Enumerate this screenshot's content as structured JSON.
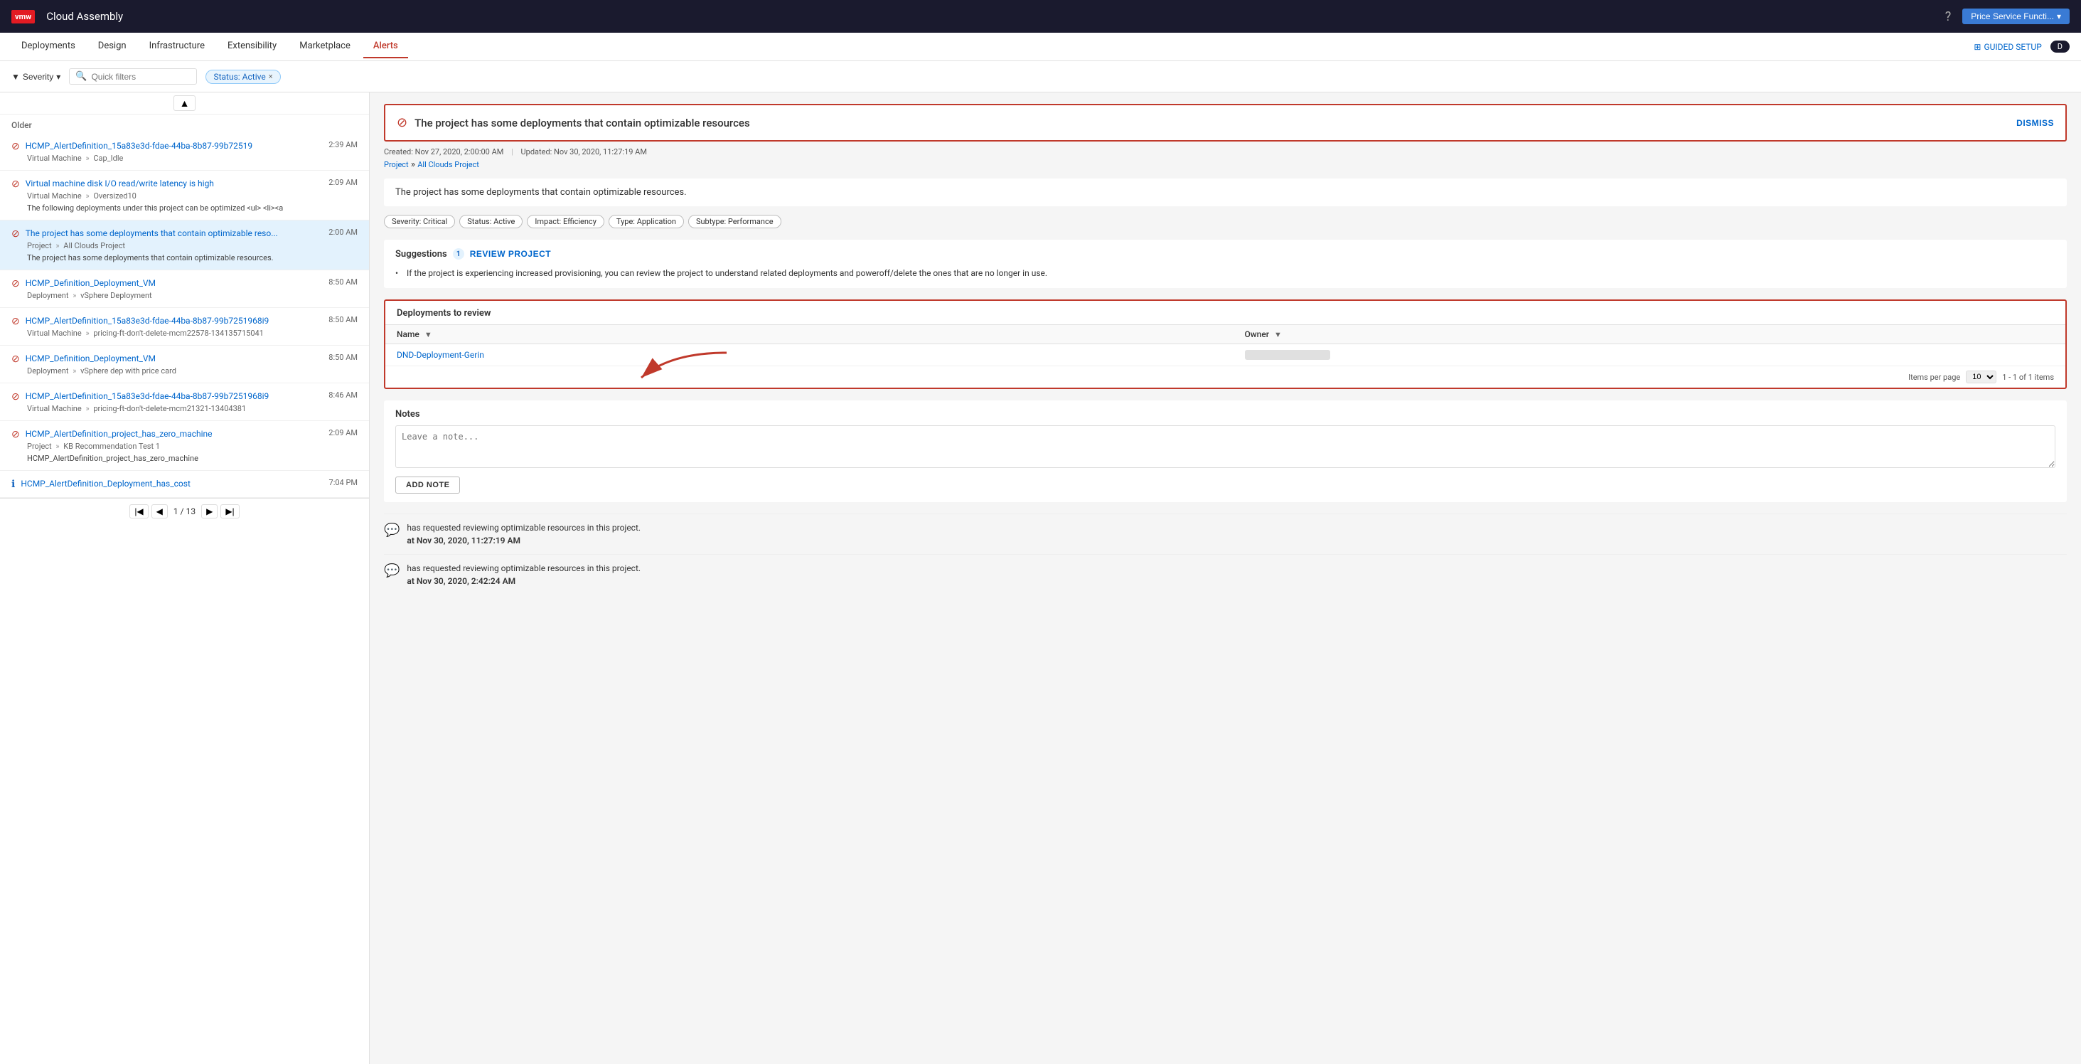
{
  "app": {
    "logo": "vmw",
    "title": "Cloud Assembly"
  },
  "topnav": {
    "user_label": "Price Service Functi...",
    "help_icon": "?",
    "chevron_icon": "▾"
  },
  "menubar": {
    "items": [
      {
        "label": "Deployments",
        "active": false
      },
      {
        "label": "Design",
        "active": false
      },
      {
        "label": "Infrastructure",
        "active": false
      },
      {
        "label": "Extensibility",
        "active": false
      },
      {
        "label": "Marketplace",
        "active": false
      },
      {
        "label": "Alerts",
        "active": true
      }
    ],
    "guided_setup": "GUIDED SETUP",
    "dark_toggle": "D"
  },
  "filterbar": {
    "severity_label": "Severity",
    "quick_filters_placeholder": "Quick filters",
    "status_badge": "Status: Active",
    "status_badge_x": "×"
  },
  "left_panel": {
    "section_label": "Older",
    "alerts": [
      {
        "id": "alert-1",
        "icon_type": "error",
        "title": "HCMP_AlertDefinition_15a83e3d-fdae-44ba-8b87-99b72519",
        "time": "2:39 AM",
        "sub": "Virtual Machine » Cap_Idle",
        "desc": ""
      },
      {
        "id": "alert-2",
        "icon_type": "error",
        "title": "Virtual machine disk I/O read/write latency is high",
        "time": "2:09 AM",
        "sub": "Virtual Machine » Oversized10",
        "desc": "The following deployments under this project can be optimized <ul> <li><a"
      },
      {
        "id": "alert-3",
        "icon_type": "error",
        "title": "The project has some deployments that contain optimizable reso...",
        "time": "2:00 AM",
        "sub": "Project » All Clouds Project",
        "desc": "The project has some deployments that contain optimizable resources.",
        "selected": true
      },
      {
        "id": "alert-4",
        "icon_type": "error",
        "title": "HCMP_Definition_Deployment_VM",
        "time": "8:50 AM",
        "sub": "Deployment » vSphere Deployment",
        "desc": ""
      },
      {
        "id": "alert-5",
        "icon_type": "error",
        "title": "HCMP_AlertDefinition_15a83e3d-fdae-44ba-8b87-99b7251968i9",
        "time": "8:50 AM",
        "sub": "Virtual Machine » pricing-ft-don't-delete-mcm22578-134135715041",
        "desc": ""
      },
      {
        "id": "alert-6",
        "icon_type": "error",
        "title": "HCMP_Definition_Deployment_VM",
        "time": "8:50 AM",
        "sub": "Deployment » vSphere dep with price card",
        "desc": ""
      },
      {
        "id": "alert-7",
        "icon_type": "error",
        "title": "HCMP_AlertDefinition_15a83e3d-fdae-44ba-8b87-99b7251968i9",
        "time": "8:46 AM",
        "sub": "Virtual Machine » pricing-ft-don't-delete-mcm21321-13404381",
        "desc": ""
      },
      {
        "id": "alert-8",
        "icon_type": "error",
        "title": "HCMP_AlertDefinition_project_has_zero_machine",
        "time": "2:09 AM",
        "sub": "Project » KB Recommendation Test 1",
        "desc": "HCMP_AlertDefinition_project_has_zero_machine"
      },
      {
        "id": "alert-9",
        "icon_type": "info",
        "title": "HCMP_AlertDefinition_Deployment_has_cost",
        "time": "7:04 PM",
        "sub": "",
        "desc": ""
      }
    ],
    "pagination": {
      "page": "1",
      "total_pages": "13",
      "prev_disabled": true,
      "next_disabled": false
    }
  },
  "right_panel": {
    "alert_title": "The project has some deployments that contain optimizable resources",
    "dismiss_label": "DISMISS",
    "meta_created": "Created: Nov 27, 2020, 2:00:00 AM",
    "meta_updated": "Updated: Nov 30, 2020, 11:27:19 AM",
    "meta_sep": "|",
    "project_label": "Project",
    "project_link": "All Clouds Project",
    "description": "The project has some deployments that contain optimizable resources.",
    "tags": [
      {
        "label": "Severity: Critical"
      },
      {
        "label": "Status: Active"
      },
      {
        "label": "Impact: Efficiency"
      },
      {
        "label": "Type: Application"
      },
      {
        "label": "Subtype: Performance"
      }
    ],
    "suggestions": {
      "title": "Suggestions",
      "count": "1",
      "review_btn": "REVIEW PROJECT",
      "items": [
        "If the project is experiencing increased provisioning, you can review the project to understand related deployments and poweroff/delete the ones that are no longer in use."
      ]
    },
    "deployments_box": {
      "title": "Deployments to review",
      "columns": [
        {
          "label": "Name"
        },
        {
          "label": "Owner"
        }
      ],
      "rows": [
        {
          "name": "DND-Deployment-Gerin",
          "owner": ""
        }
      ],
      "items_per_page_label": "Items per page",
      "items_per_page_value": "10",
      "count_label": "1 - 1 of 1 items"
    },
    "notes": {
      "title": "Notes",
      "placeholder": "Leave a note...",
      "add_btn": "ADD NOTE"
    },
    "activity": [
      {
        "icon": "💬",
        "text": "has requested reviewing optimizable resources in this project.",
        "time": "at Nov 30, 2020, 11:27:19 AM"
      },
      {
        "icon": "💬",
        "text": "has requested reviewing optimizable resources in this project.",
        "time": "at Nov 30, 2020, 2:42:24 AM"
      }
    ]
  }
}
